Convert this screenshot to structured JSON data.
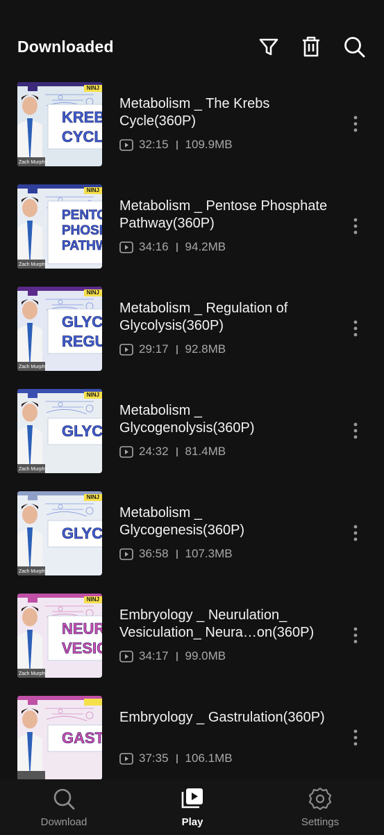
{
  "header": {
    "title": "Downloaded",
    "icons": [
      "filter-icon",
      "trash-icon",
      "search-icon"
    ]
  },
  "items": [
    {
      "title": "Metabolism _ The Krebs Cycle(360P)",
      "duration": "32:15",
      "size": "109.9MB",
      "thumb": {
        "bg": "#dfe8ef",
        "band": "#3b2a7a",
        "accent": "#3f5fd1",
        "label_lines": [
          "KREB",
          "CYCL"
        ],
        "label_color": "#3f5fd1",
        "label_bg": "#ffffff",
        "credit": "Zach Murphy",
        "brand": "NINJ"
      }
    },
    {
      "title": "Metabolism _ Pentose Phosphate Pathway(360P)",
      "duration": "34:16",
      "size": "94.2MB",
      "thumb": {
        "bg": "#e7ecf3",
        "band": "#2f3f9a",
        "accent": "#3f5fd1",
        "label_lines": [
          "PENTO",
          "PHOSPH",
          "PATHW"
        ],
        "label_color": "#3f5fd1",
        "label_bg": "#ffffff",
        "credit": "Zach Murphy",
        "brand": "NINJ"
      }
    },
    {
      "title": "Metabolism _ Regulation of Glycolysis(360P)",
      "duration": "29:17",
      "size": "92.8MB",
      "thumb": {
        "bg": "#e3e8f4",
        "band": "#5b2a8a",
        "accent": "#3f5fd1",
        "label_lines": [
          "GLYCOL",
          "REGULA"
        ],
        "label_color": "#3f5fd1",
        "label_bg": "#ffffff",
        "credit": "Zach Murphy",
        "brand": "NINJ"
      }
    },
    {
      "title": "Metabolism _ Glycogenolysis(360P)",
      "duration": "24:32",
      "size": "81.4MB",
      "thumb": {
        "bg": "#e8edf2",
        "band": "#3b4fb0",
        "accent": "#3f5fd1",
        "label_lines": [
          "GLYCOGEN"
        ],
        "label_color": "#3f5fd1",
        "label_bg": "#ffffff",
        "credit": "Zach Murphy",
        "brand": "NINJ"
      }
    },
    {
      "title": "Metabolism _ Glycogenesis(360P)",
      "duration": "36:58",
      "size": "107.3MB",
      "thumb": {
        "bg": "#e9eef4",
        "band": "#8fa0c8",
        "accent": "#3f5fd1",
        "label_lines": [
          "GLYCOGE"
        ],
        "label_color": "#3f5fd1",
        "label_bg": "#ffffff",
        "credit": "Zach Murphy",
        "brand": "NINJ"
      }
    },
    {
      "title": "Embryology _ Neurulation_ Vesiculation_ Neura…on(360P)",
      "duration": "34:17",
      "size": "99.0MB",
      "thumb": {
        "bg": "#f1e7f2",
        "band": "#c04fa6",
        "accent": "#c04fa6",
        "label_lines": [
          "NEURULA",
          "VESICULA"
        ],
        "label_color": "#d24fb3",
        "label_bg": "#ffffff",
        "credit": "Zach Murphy",
        "brand": "NINJ"
      }
    },
    {
      "title": "Embryology _ Gastrulation(360P)",
      "duration": "37:35",
      "size": "106.1MB",
      "thumb": {
        "bg": "#f2e8f2",
        "band": "#c04fa6",
        "accent": "#c04fa6",
        "label_lines": [
          "GASTRUL"
        ],
        "label_color": "#d24fb3",
        "label_bg": "#ffffff",
        "credit": "",
        "brand": ""
      }
    }
  ],
  "nav": [
    {
      "label": "Download",
      "icon": "search-icon",
      "active": false
    },
    {
      "label": "Play",
      "icon": "play-library-icon",
      "active": true
    },
    {
      "label": "Settings",
      "icon": "gear-icon",
      "active": false
    }
  ]
}
